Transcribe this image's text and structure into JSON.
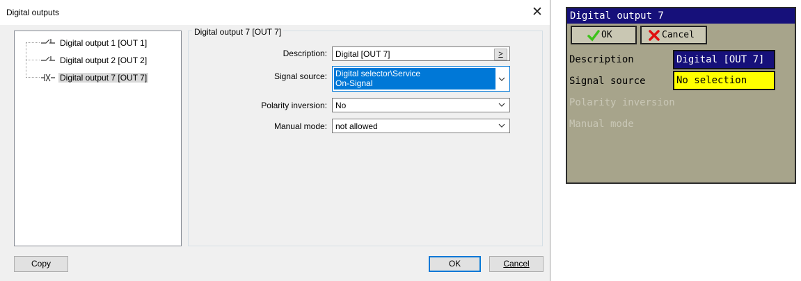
{
  "dialog": {
    "title": "Digital outputs",
    "close_glyph": "✕",
    "tree": [
      {
        "label": "Digital output 1 [OUT 1]",
        "icon": "switch-open-icon"
      },
      {
        "label": "Digital output 2 [OUT 2]",
        "icon": "switch-open-icon"
      },
      {
        "label": "Digital output 7 [OUT 7]",
        "icon": "switch-inverted-icon",
        "selected": true
      }
    ],
    "group_title": "Digital output 7 [OUT 7]",
    "fields": {
      "description": {
        "label": "Description:",
        "value": "Digital [OUT 7]",
        "button": ">"
      },
      "signal_source": {
        "label": "Signal source:",
        "value_line1": "Digital selector\\Service",
        "value_line2": "On-Signal"
      },
      "polarity_inversion": {
        "label": "Polarity inversion:",
        "value": "No"
      },
      "manual_mode": {
        "label": "Manual mode:",
        "value": "not allowed"
      }
    },
    "buttons": {
      "copy": "Copy",
      "ok": "OK",
      "cancel": "Cancel"
    }
  },
  "device_panel": {
    "title": "Digital output 7",
    "ok_label": "OK",
    "cancel_label": "Cancel",
    "rows": {
      "description": {
        "label": "Description",
        "value": "Digital [OUT 7]"
      },
      "signal_source": {
        "label": "Signal source",
        "value": "No selection"
      },
      "polarity_inversion": {
        "label": "Polarity inversion"
      },
      "manual_mode": {
        "label": "Manual mode"
      }
    },
    "colors": {
      "title_bg": "#16107a",
      "panel_bg": "#a7a48b",
      "highlight": "#ffff00",
      "check": "#3cc21a",
      "cross": "#e11010"
    }
  }
}
